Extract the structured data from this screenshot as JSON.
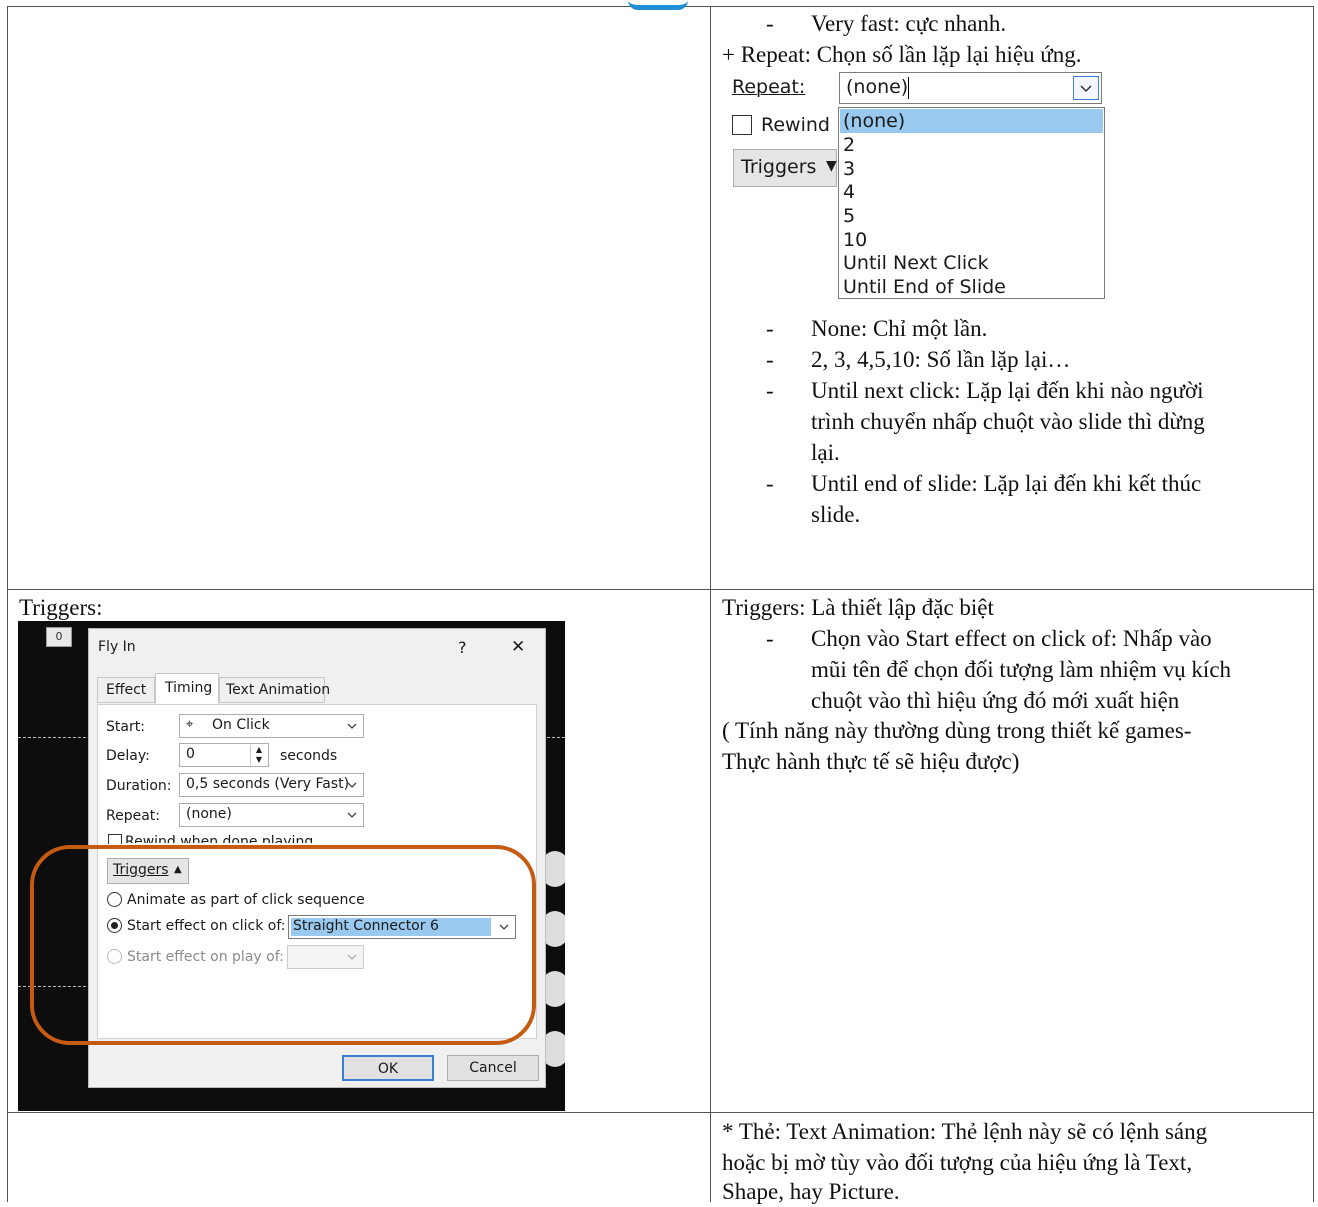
{
  "top_right": {
    "bullet_very_fast": "Very fast: cực nhanh.",
    "repeat_intro": "+ Repeat: Chọn số lần lặp lại hiệu ứng.",
    "repeat_label": "Repeat:",
    "repeat_value": "(none)",
    "rewind_label": "Rewind",
    "triggers_label": "Triggers",
    "repeat_options": [
      "(none)",
      "2",
      "3",
      "4",
      "5",
      "10",
      "Until Next Click",
      "Until End of Slide"
    ],
    "bullets": [
      [
        "None: Chỉ một lần."
      ],
      [
        "2, 3, 4,5,10: Số lần lặp lại…"
      ],
      [
        "Until next click: Lặp lại đến khi nào người",
        "trình chuyển nhấp chuột vào slide thì dừng",
        "lại."
      ],
      [
        "Until end of slide: Lặp lại đến khi kết thúc",
        "slide."
      ]
    ]
  },
  "middle_left": {
    "heading": "Triggers:",
    "dialog": {
      "slide_number": "0",
      "title": "Fly In",
      "help": "?",
      "close": "✕",
      "tabs": [
        "Effect",
        "Timing",
        "Text Animation"
      ],
      "start_label": "Start:",
      "start_value": "On Click",
      "delay_label": "Delay:",
      "delay_value": "0",
      "delay_unit": "seconds",
      "duration_label": "Duration:",
      "duration_value": "0,5 seconds (Very Fast)",
      "repeat_label": "Repeat:",
      "repeat_value": "(none)",
      "rewind_label": "Rewind when done playing",
      "triggers_button": "Triggers",
      "radio_sequence": "Animate as part of click sequence",
      "radio_click_of": "Start effect on click of:",
      "click_of_value": "Straight Connector 6",
      "radio_play_of": "Start effect on play of:",
      "ok": "OK",
      "cancel": "Cancel"
    },
    "highlight_color": "#c55a11"
  },
  "middle_right": {
    "line1": "Triggers: Là thiết lập đặc biệt",
    "bullet_lines": [
      "Chọn vào Start effect on click of: Nhấp vào",
      "mũi tên để chọn đối tượng làm nhiệm vụ kích",
      "chuột vào thì hiệu ứng đó mới xuất hiện"
    ],
    "note_lines": [
      "( Tính năng này thường dùng trong thiết kế games-",
      "Thực hành thực tế sẽ hiệu được)"
    ]
  },
  "bottom_right": {
    "lines": [
      "* Thẻ: Text Animation: Thẻ lệnh này sẽ có lệnh sáng",
      "hoặc bị mờ tùy vào đối tượng của hiệu ứng là Text,",
      "Shape, hay Picture."
    ]
  }
}
